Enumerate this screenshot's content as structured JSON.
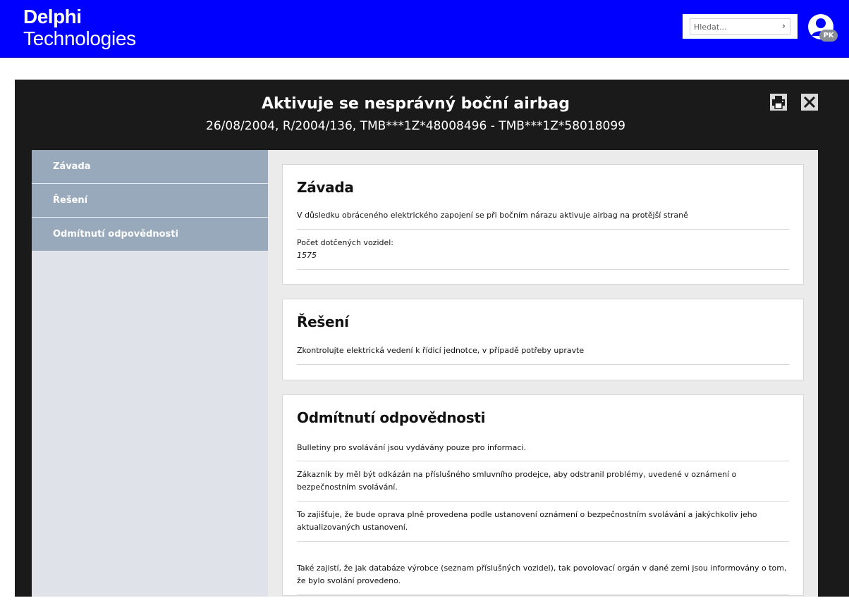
{
  "header": {
    "logo_line1": "Delphi",
    "logo_line2": "Technologies",
    "search_placeholder": "Hledat...",
    "search_arrow": "›",
    "avatar_initials": "PK",
    "brand_color": "#0000ff"
  },
  "modal": {
    "title": "Aktivuje se nesprávný boční airbag",
    "subtitle": "26/08/2004, R/2004/136, TMB***1Z*48008496 - TMB***1Z*58018099",
    "print_icon": "printer-icon",
    "close_icon": "close-icon"
  },
  "sidenav": {
    "items": [
      {
        "label": "Závada"
      },
      {
        "label": "Řešení"
      },
      {
        "label": "Odmítnutí odpovědnosti"
      }
    ]
  },
  "sections": {
    "zavada": {
      "title": "Závada",
      "description": "V důsledku obráceného elektrického zapojení se při bočním nárazu aktivuje airbag na protější straně",
      "affected_label": "Počet dotčených vozidel:",
      "affected_value": "1575"
    },
    "reseni": {
      "title": "Řešení",
      "description": "Zkontrolujte elektrická vedení k řídicí jednotce, v případě potřeby upravte"
    },
    "disclaimer": {
      "title": "Odmítnutí odpovědnosti",
      "paragraphs": [
        "Bulletiny pro svolávání jsou vydávány pouze pro informaci.",
        "Zákazník by měl být odkázán na příslušného smluvního prodejce, aby odstranil problémy, uvedené v oznámení o bezpečnostním svolávání.",
        "To zajišťuje, že bude oprava plně provedena podle ustanovení oznámení o bezpečnostním svolávání a jakýchkoliv jeho aktualizovaných ustanovení.",
        "Také zajistí, že jak databáze výrobce (seznam příslušných vozidel), tak povolovací orgán v dané zemi jsou informovány o tom, že bylo svolání provedeno."
      ]
    }
  }
}
